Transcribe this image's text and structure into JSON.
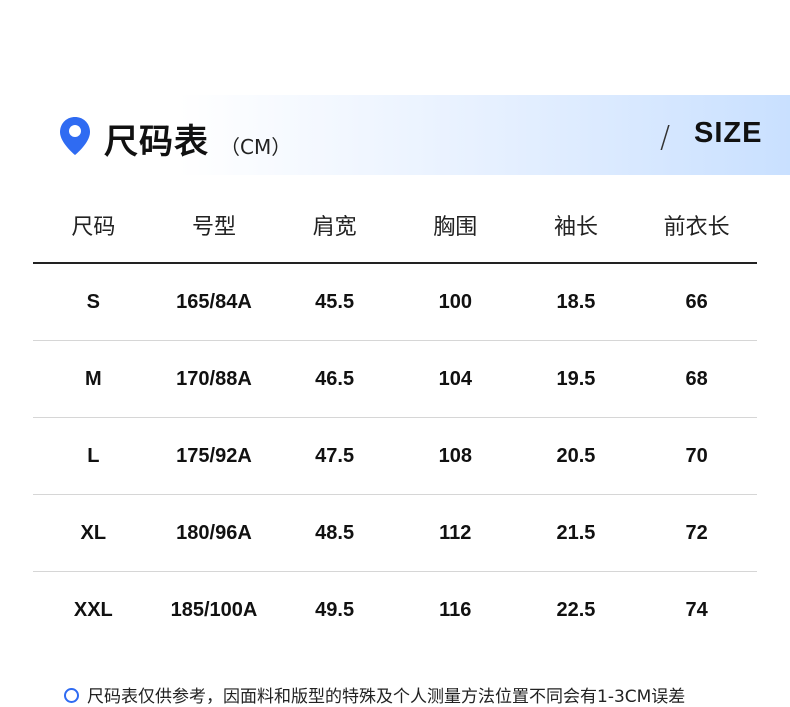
{
  "header": {
    "title": "尺码表",
    "unit": "（CM）",
    "slash": "/",
    "size_label": "SIZE",
    "accent_color": "#2f6bf2"
  },
  "table": {
    "columns": [
      "尺码",
      "号型",
      "肩宽",
      "胸围",
      "袖长",
      "前衣长"
    ],
    "rows": [
      [
        "S",
        "165/84A",
        "45.5",
        "100",
        "18.5",
        "66"
      ],
      [
        "M",
        "170/88A",
        "46.5",
        "104",
        "19.5",
        "68"
      ],
      [
        "L",
        "175/92A",
        "47.5",
        "108",
        "20.5",
        "70"
      ],
      [
        "XL",
        "180/96A",
        "48.5",
        "112",
        "21.5",
        "72"
      ],
      [
        "XXL",
        "185/100A",
        "49.5",
        "116",
        "22.5",
        "74"
      ]
    ]
  },
  "footnote": {
    "icon": "circle-outline-icon",
    "text": "尺码表仅供参考，因面料和版型的特殊及个人测量方法位置不同会有1-3CM误差"
  }
}
